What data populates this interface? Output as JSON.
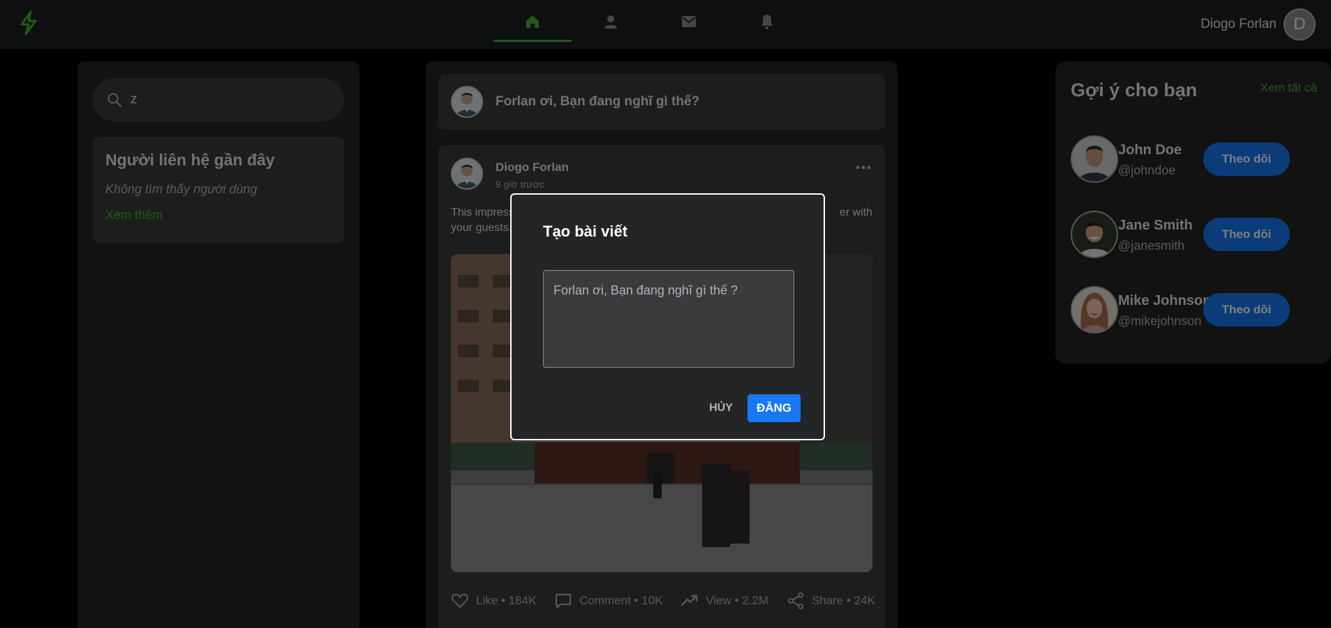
{
  "colors": {
    "accent": "#42b72a",
    "primary": "#1877f2",
    "bg": "#000000",
    "card": "#242526"
  },
  "topbar": {
    "logo_icon": "lightning-bolt-icon",
    "nav": [
      {
        "icon": "home-icon",
        "active": true
      },
      {
        "icon": "user-icon",
        "active": false
      },
      {
        "icon": "mail-icon",
        "active": false
      },
      {
        "icon": "bell-icon",
        "active": false
      }
    ],
    "user_name": "Diogo Forlan",
    "avatar_letter": "D"
  },
  "left": {
    "search_value": "z",
    "contacts_title": "Người liên hệ gần đây",
    "contacts_empty": "Không tìm thấy người dùng",
    "see_more": "Xem thêm"
  },
  "feed": {
    "composer_prompt": "Forlan ơi, Bạn đang nghĩ gì thế?",
    "post": {
      "author": "Diogo Forlan",
      "time": "9 giờ trước",
      "text_left": "This impress",
      "text_right": "er with",
      "text_line2": "your guests.",
      "actions": {
        "like": "Like • 184K",
        "comment": "Comment • 10K",
        "view": "View • 2.2M",
        "share": "Share • 24K"
      }
    }
  },
  "suggestions": {
    "title": "Gợi ý cho bạn",
    "see_all": "Xem tất cả",
    "items": [
      {
        "name": "John Doe",
        "handle": "@johndoe",
        "button": "Theo dõi"
      },
      {
        "name": "Jane Smith",
        "handle": "@janesmith",
        "button": "Theo dõi"
      },
      {
        "name": "Mike Johnson",
        "handle": "@mikejohnson",
        "button": "Theo dõi"
      }
    ]
  },
  "modal": {
    "title": "Tạo bài viết",
    "placeholder": "Forlan ơi, Bạn đang nghĩ gì thế ?",
    "cancel": "HỦY",
    "submit": "ĐĂNG"
  }
}
